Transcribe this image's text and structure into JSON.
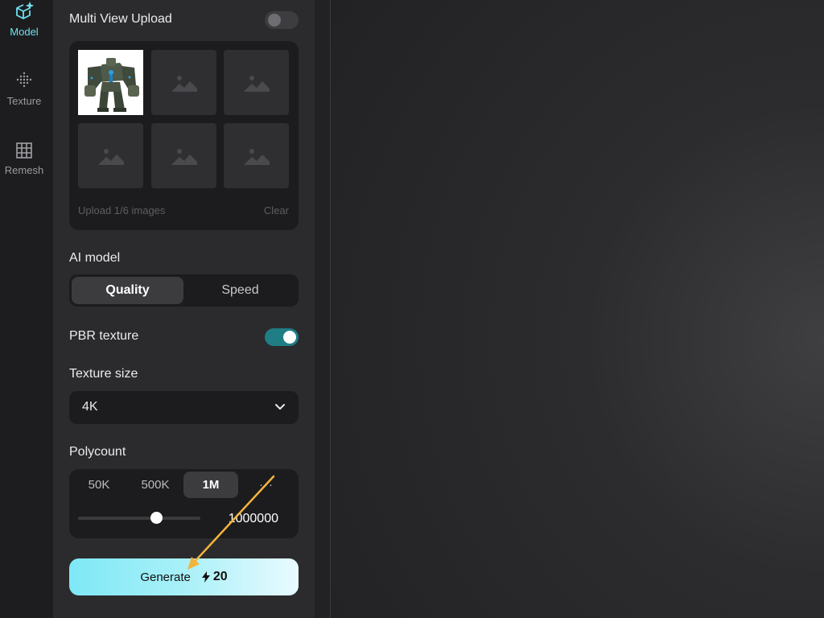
{
  "sidebar": {
    "items": [
      {
        "label": "Model",
        "icon": "cube-sparkle-icon",
        "active": true
      },
      {
        "label": "Texture",
        "icon": "dots-diamond-icon",
        "active": false
      },
      {
        "label": "Remesh",
        "icon": "grid-icon",
        "active": false
      }
    ]
  },
  "multi_view": {
    "title": "Multi View Upload",
    "toggle_on": false,
    "upload_count": "Upload 1/6 images",
    "clear_label": "Clear",
    "slot_icon": "image-placeholder-icon"
  },
  "ai_model": {
    "title": "AI model",
    "options": [
      "Quality",
      "Speed"
    ],
    "selected": "Quality"
  },
  "pbr": {
    "title": "PBR texture",
    "toggle_on": true
  },
  "texture_size": {
    "title": "Texture size",
    "value": "4K"
  },
  "polycount": {
    "title": "Polycount",
    "options": [
      "50K",
      "500K",
      "1M",
      "···"
    ],
    "selected": "1M",
    "value": "1000000",
    "slider_fraction": 0.64
  },
  "generate": {
    "label": "Generate",
    "cost": "20"
  },
  "colors": {
    "accent": "#6fe0f0",
    "toggle_on": "#1f7d86",
    "annotation_arrow": "#f2b43c"
  }
}
